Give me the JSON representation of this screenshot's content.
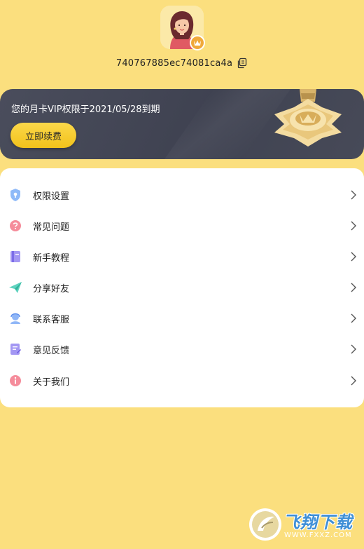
{
  "profile": {
    "uid": "740767885ec74081ca4a"
  },
  "vip": {
    "notice": "您的月卡VIP权限于2021/05/28到期",
    "renew_label": "立即续费"
  },
  "menu": {
    "items": [
      {
        "label": "权限设置",
        "icon": "shield-icon",
        "color": "#6fa8f6"
      },
      {
        "label": "常见问题",
        "icon": "question-icon",
        "color": "#f57a8c"
      },
      {
        "label": "新手教程",
        "icon": "book-icon",
        "color": "#8a7cf0"
      },
      {
        "label": "分享好友",
        "icon": "paper-plane-icon",
        "color": "#3fc7b0"
      },
      {
        "label": "联系客服",
        "icon": "customer-service-icon",
        "color": "#7fa9f5"
      },
      {
        "label": "意见反馈",
        "icon": "feedback-icon",
        "color": "#8a7cf0"
      },
      {
        "label": "关于我们",
        "icon": "info-icon",
        "color": "#f57a8c"
      }
    ]
  },
  "watermark": {
    "brand": "飞翔下载",
    "url": "WWW.FXXZ.COM"
  }
}
